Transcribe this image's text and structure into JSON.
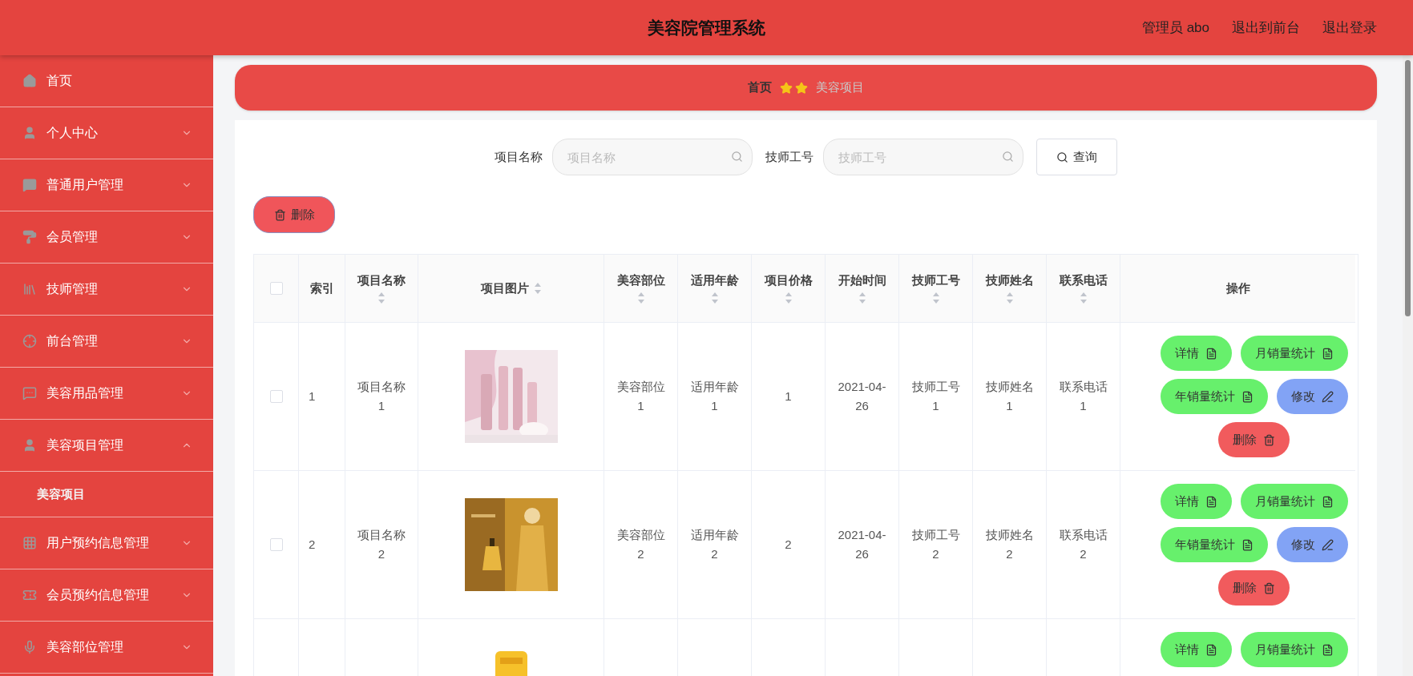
{
  "header": {
    "title": "美容院管理系统",
    "links": [
      "管理员 abo",
      "退出到前台",
      "退出登录"
    ]
  },
  "sidebar": {
    "items": [
      {
        "label": "首页",
        "kind": "link"
      },
      {
        "label": "个人中心",
        "kind": "menu",
        "expanded": false
      },
      {
        "label": "普通用户管理",
        "kind": "menu",
        "expanded": false
      },
      {
        "label": "会员管理",
        "kind": "menu",
        "expanded": false
      },
      {
        "label": "技师管理",
        "kind": "menu",
        "expanded": false
      },
      {
        "label": "前台管理",
        "kind": "menu",
        "expanded": false
      },
      {
        "label": "美容用品管理",
        "kind": "menu",
        "expanded": false
      },
      {
        "label": "美容项目管理",
        "kind": "menu",
        "expanded": true,
        "children": [
          {
            "label": "美容项目"
          }
        ]
      },
      {
        "label": "用户预约信息管理",
        "kind": "menu",
        "expanded": false
      },
      {
        "label": "会员预约信息管理",
        "kind": "menu",
        "expanded": false
      },
      {
        "label": "美容部位管理",
        "kind": "menu",
        "expanded": false
      }
    ]
  },
  "breadcrumb": [
    {
      "label": "首页",
      "current": false
    },
    {
      "label": "美容项目",
      "current": true
    }
  ],
  "search": {
    "fields": [
      {
        "label": "项目名称",
        "placeholder": "项目名称"
      },
      {
        "label": "技师工号",
        "placeholder": "技师工号"
      }
    ],
    "button": "查询"
  },
  "delete_button": "删除",
  "table": {
    "columns": [
      {
        "kind": "checkbox",
        "checked": false
      },
      {
        "label": "索引",
        "kind": "text",
        "sortable": false
      },
      {
        "label": "项目名称",
        "kind": "text",
        "sortable": true
      },
      {
        "label": "项目图片",
        "kind": "picture",
        "sortable": true
      },
      {
        "label": "美容部位",
        "kind": "text",
        "sortable": true
      },
      {
        "label": "适用年龄",
        "kind": "text",
        "sortable": true
      },
      {
        "label": "项目价格",
        "kind": "text",
        "sortable": true
      },
      {
        "label": "开始时间",
        "kind": "text",
        "sortable": true
      },
      {
        "label": "技师工号",
        "kind": "text",
        "sortable": true
      },
      {
        "label": "技师姓名",
        "kind": "text",
        "sortable": true
      },
      {
        "label": "联系电话",
        "kind": "text",
        "sortable": true
      },
      {
        "label": "操作",
        "kind": "actions",
        "sortable": false
      }
    ],
    "rows": [
      {
        "cells": [
          {
            "kind": "checkbox",
            "checked": false
          },
          "1",
          "项目名称 1",
          {
            "kind": "picture"
          },
          "美容部位 1",
          "适用年龄 1",
          "1",
          "2021-04-26",
          "技师工号 1",
          "技师姓名 1",
          "联系电话 1",
          {
            "kind": "actions",
            "buttons": [
              {
                "label": "详情",
                "kind": "detail"
              },
              {
                "label": "月销量统计",
                "kind": "detail"
              },
              {
                "label": "年销量统计",
                "kind": "detail"
              },
              {
                "label": "修改",
                "kind": "edit"
              },
              {
                "label": "删除",
                "kind": "delete"
              }
            ]
          }
        ]
      },
      {
        "cells": [
          {
            "kind": "checkbox",
            "checked": false
          },
          "2",
          "项目名称 2",
          {
            "kind": "picture"
          },
          "美容部位 2",
          "适用年龄 2",
          "2",
          "2021-04-26",
          "技师工号 2",
          "技师姓名 2",
          "联系电话 2",
          {
            "kind": "actions",
            "buttons": [
              {
                "label": "详情",
                "kind": "detail"
              },
              {
                "label": "月销量统计",
                "kind": "detail"
              },
              {
                "label": "年销量统计",
                "kind": "detail"
              },
              {
                "label": "修改",
                "kind": "edit"
              },
              {
                "label": "删除",
                "kind": "delete"
              }
            ]
          }
        ]
      },
      {
        "cells": [
          "",
          "",
          "",
          {
            "kind": "picture"
          },
          "",
          "",
          "",
          "",
          "",
          "",
          "",
          {
            "kind": "actions",
            "buttons": [
              {
                "label": "详情",
                "kind": "detail"
              },
              {
                "label": "月销量统计",
                "kind": "detail"
              }
            ]
          }
        ]
      }
    ]
  }
}
